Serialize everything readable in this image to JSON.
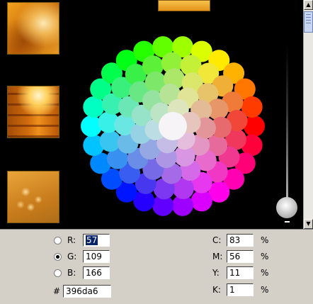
{
  "viewer": {
    "thumbnails": [
      "sunset-leaf-photo",
      "building-sunset-photo",
      "orange-flowers-photo"
    ]
  },
  "slider": {
    "value_fraction": 0.95
  },
  "rgb": {
    "r_label": "R:",
    "r_value": "57",
    "g_label": "G:",
    "g_value": "109",
    "b_label": "B:",
    "b_value": "166",
    "selected_channel": "G"
  },
  "hex": {
    "label": "#",
    "value": "396da6"
  },
  "cmyk": {
    "c_label": "C:",
    "c_value": "83",
    "m_label": "M:",
    "m_value": "56",
    "y_label": "Y:",
    "y_value": "11",
    "k_label": "K:",
    "k_value": "1",
    "unit": "%"
  },
  "scrollbar": {
    "up_icon": "▲",
    "down_icon": "▼"
  }
}
